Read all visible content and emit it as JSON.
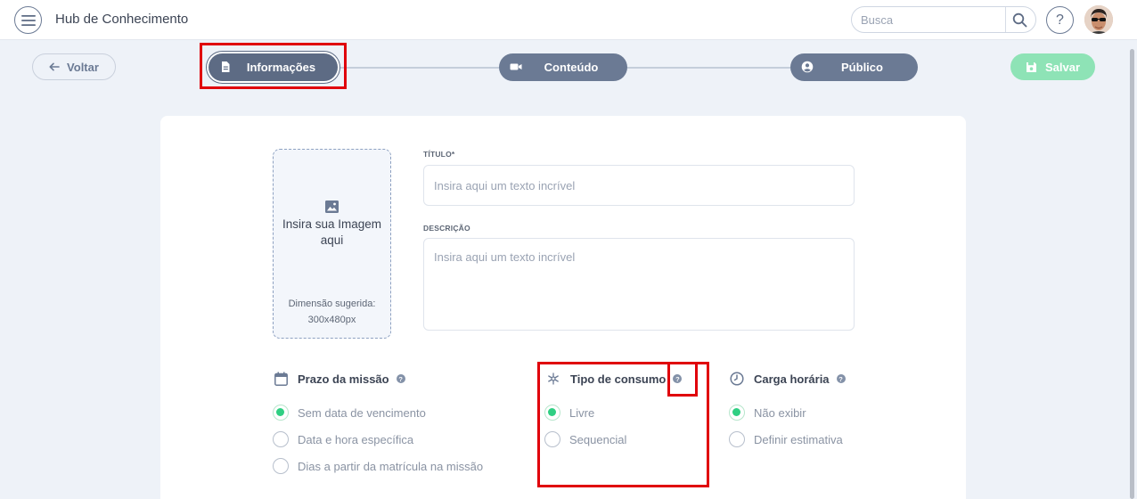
{
  "header": {
    "app_title": "Hub de Conhecimento",
    "search_placeholder": "Busca",
    "help_label": "?"
  },
  "stepper": {
    "back_label": "Voltar",
    "steps": [
      {
        "label": "Informações",
        "icon": "document-icon",
        "active": true
      },
      {
        "label": "Conteúdo",
        "icon": "video-camera-icon",
        "active": false
      },
      {
        "label": "Público",
        "icon": "user-circle-icon",
        "active": false
      }
    ],
    "save_label": "Salvar"
  },
  "form": {
    "image_upload": {
      "title": "Insira sua Imagem aqui",
      "hint": "Dimensão sugerida: 300x480px"
    },
    "title_label": "TÍTULO*",
    "title_placeholder": "Insira aqui um texto incrível",
    "description_label": "DESCRIÇÃO",
    "description_placeholder": "Insira aqui um texto incrível"
  },
  "options": {
    "prazo": {
      "title": "Prazo da missão",
      "help": "?",
      "choices": [
        "Sem data de vencimento",
        "Data e hora específica",
        "Dias a partir da matrícula na missão"
      ],
      "selected": 0
    },
    "consumo": {
      "title": "Tipo de consumo",
      "help": "?",
      "choices": [
        "Livre",
        "Sequencial"
      ],
      "selected": 0
    },
    "carga": {
      "title": "Carga horária",
      "help": "?",
      "choices": [
        "Não exibir",
        "Definir estimativa"
      ],
      "selected": 0
    }
  },
  "colors": {
    "primary": "#6b7a94",
    "success": "#2fcf82",
    "save_disabled": "#8ee3b6",
    "highlight": "#e0000b"
  }
}
